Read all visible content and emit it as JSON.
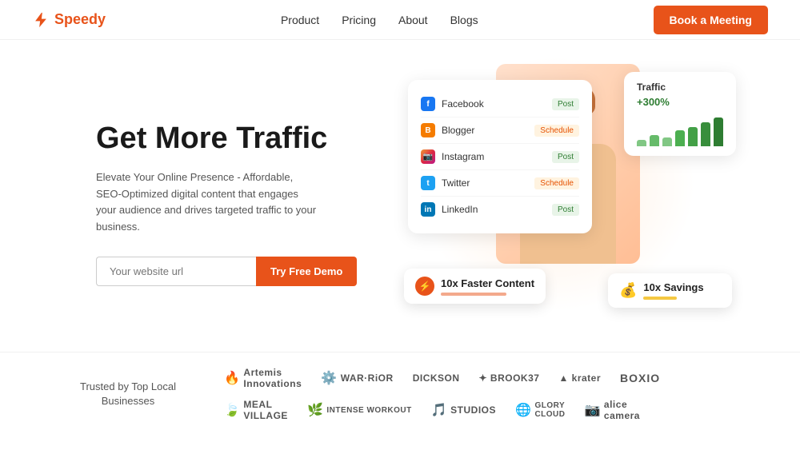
{
  "navbar": {
    "logo_text": "Speedy",
    "nav_items": [
      "Product",
      "Pricing",
      "About",
      "Blogs"
    ],
    "book_btn": "Book a Meeting"
  },
  "hero": {
    "title": "Get More Traffic",
    "subtitle": "Elevate Your Online Presence - Affordable, SEO-Optimized digital content that engages your audience and drives targeted traffic to your business.",
    "input_placeholder": "Your website url",
    "cta_label": "Try Free Demo"
  },
  "social_card": {
    "rows": [
      {
        "platform": "Facebook",
        "badge": "Post",
        "badge_type": "post"
      },
      {
        "platform": "Blogger",
        "badge": "Schedule",
        "badge_type": "schedule"
      },
      {
        "platform": "Instagram",
        "badge": "Post",
        "badge_type": "post"
      },
      {
        "platform": "Twitter",
        "badge": "Schedule",
        "badge_type": "schedule"
      },
      {
        "platform": "LinkedIn",
        "badge": "Post",
        "badge_type": "post"
      }
    ]
  },
  "traffic_card": {
    "title": "Traffic",
    "percent": "+300%",
    "bars": [
      20,
      35,
      28,
      45,
      55,
      70,
      80
    ]
  },
  "faster_badge": {
    "text": "10x Faster Content",
    "bar_width": "70%"
  },
  "savings_badge": {
    "text": "10x Savings",
    "bar_width": "55%"
  },
  "logos": {
    "label": "Trusted by Top Local Businesses",
    "items": [
      {
        "name": "Artemis Innovations",
        "icon": "🔥"
      },
      {
        "name": "WAR·RiOR",
        "icon": "⚙️"
      },
      {
        "name": "DICKSON",
        "icon": ""
      },
      {
        "name": "BROOK37",
        "icon": "✦"
      },
      {
        "name": "▲ krater",
        "icon": ""
      },
      {
        "name": "BOXIO",
        "icon": ""
      },
      {
        "name": "🍃 MEAL VILLAGE",
        "icon": ""
      },
      {
        "name": "WORKOUT",
        "icon": "🍃"
      },
      {
        "name": "STUDIOS",
        "icon": "🎵"
      },
      {
        "name": "GLORY CLOUD",
        "icon": "🌐"
      },
      {
        "name": "📷 alice camera",
        "icon": ""
      }
    ]
  }
}
